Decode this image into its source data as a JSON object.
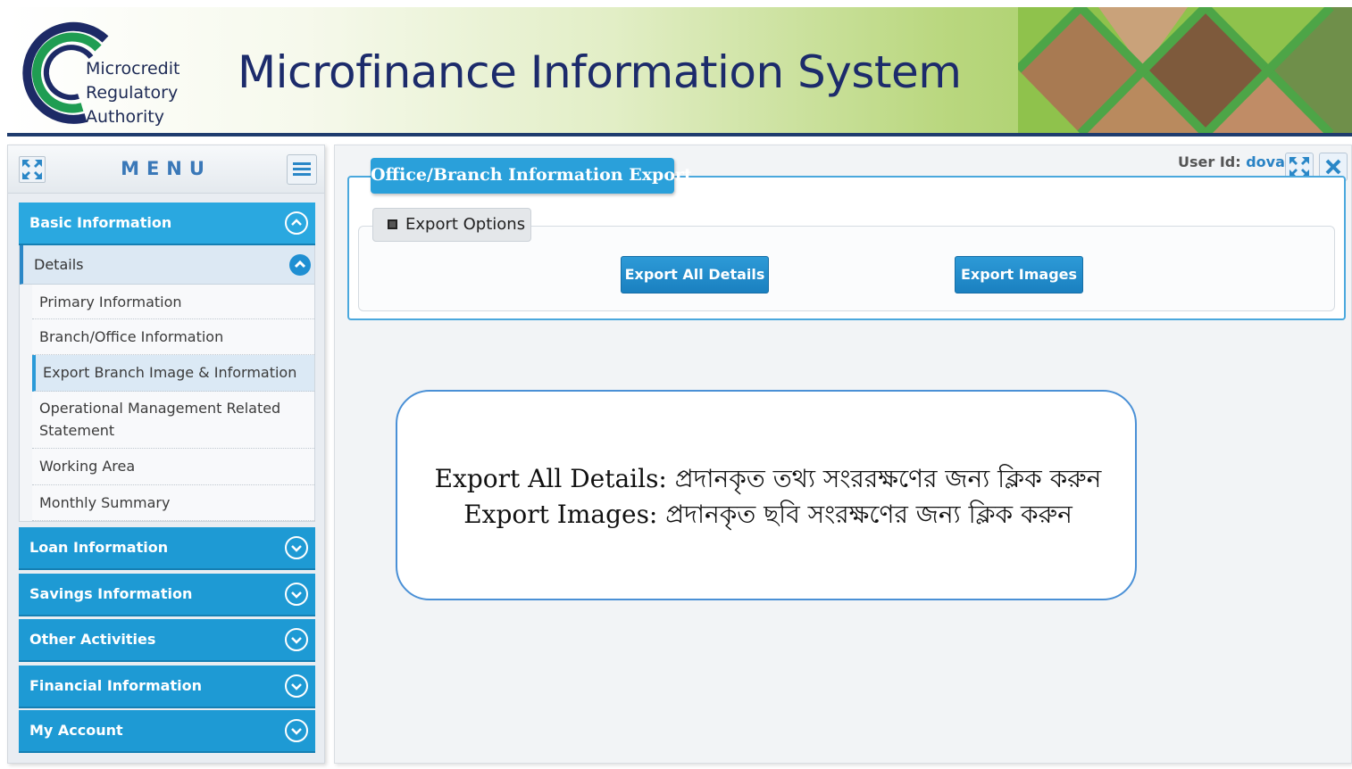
{
  "header": {
    "logo_lines": [
      "Microcredit",
      "Regulatory",
      "Authority"
    ],
    "title": "Microfinance Information System"
  },
  "sidebar": {
    "menu_title": "MENU",
    "sections": [
      {
        "label": "Basic Information",
        "expanded": true
      },
      {
        "label": "Loan Information",
        "expanded": false
      },
      {
        "label": "Savings Information",
        "expanded": false
      },
      {
        "label": "Other Activities",
        "expanded": false
      },
      {
        "label": "Financial Information",
        "expanded": false
      },
      {
        "label": "My Account",
        "expanded": false
      }
    ],
    "details_label": "Details",
    "sub_items": [
      "Primary Information",
      "Branch/Office Information",
      "Export Branch Image & Information",
      "Operational Management Related Statement",
      "Working Area",
      "Monthly Summary"
    ],
    "selected_sub_item": "Export Branch Image & Information"
  },
  "main": {
    "user_label": "User Id:",
    "user_value": "dova",
    "panel_title": "Office/Branch Information Export",
    "options_label": "Export Options",
    "buttons": {
      "export_all": "Export All Details",
      "export_images": "Export Images"
    },
    "note": {
      "line1": "Export All Details: প্রদানকৃত তথ্য সংররক্ষণের জন্য ক্লিক করুন",
      "line2": "Export Images: প্রদানকৃত ছবি সংরক্ষণের জন্য ক্লিক করুন"
    }
  },
  "colors": {
    "accent": "#1e9ad4",
    "title_text": "#1c2b6b",
    "header_rule": "#1f3c6e"
  }
}
